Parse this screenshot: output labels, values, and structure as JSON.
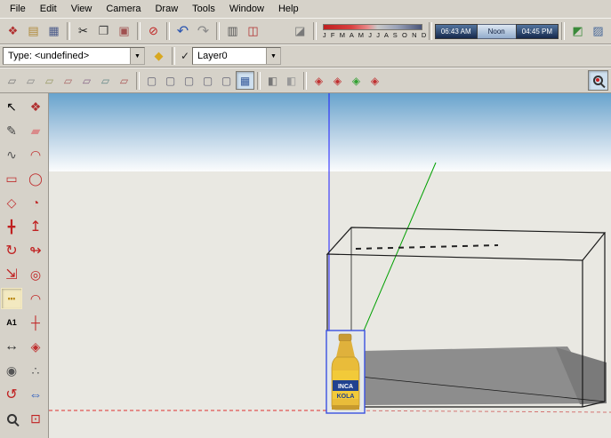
{
  "menu": [
    "File",
    "Edit",
    "View",
    "Camera",
    "Draw",
    "Tools",
    "Window",
    "Help"
  ],
  "shadows": {
    "months": "J F M A M J J A S O N D",
    "start_time": "06:43 AM",
    "noon": "Noon",
    "end_time": "04:45 PM"
  },
  "entity_info": {
    "type_field": "Type: <undefined>"
  },
  "layers": {
    "check": "✓",
    "current_layer": "Layer0"
  },
  "glyphs": {
    "make_component": "❖",
    "open": "▤",
    "save": "▦",
    "cut": "✂",
    "copy": "❐",
    "paste": "▣",
    "erase": "⊘",
    "undo": "↶",
    "redo": "↷",
    "print": "▥",
    "model_info": "◫",
    "shadow_toggle": "◪",
    "get_models": "◩",
    "share_model": "▨",
    "paint_bucket": "◆",
    "dropdown": "▼",
    "sandbox": "▱",
    "face_style": "▢",
    "face_style_active": "▦",
    "misc_view": "◧",
    "section": "◈",
    "select": "↖",
    "line": "✎",
    "eraser": "▰",
    "freehand": "∿",
    "arc": "◠",
    "rectangle": "▭",
    "circle": "◯",
    "polygon": "◇",
    "pie": "◔",
    "move": "╋",
    "push_pull": "↥",
    "rotate": "↻",
    "follow_me": "↬",
    "scale": "⇲",
    "offset": "◎",
    "tape_measure": "┅",
    "text_tool": "A1",
    "protractor": "◠",
    "axes": "┼",
    "dimension": "↔",
    "section_plane": "◈",
    "position_camera": "◉",
    "walk": "∴",
    "orbit": "↺",
    "pan": "⇔",
    "zoom_extents": "⊡"
  },
  "canvas": {
    "bottle": {
      "line1": "INCA",
      "line2": "KOLA"
    }
  },
  "colors": {
    "sky_top": "#68a3cd",
    "ground": "#e9e8e2",
    "axis_blue": "#1c1cff",
    "axis_green": "#00a000",
    "axis_red": "#e03030",
    "shadow_gray": "#8d8d8d",
    "selection_blue": "#3a50e0",
    "bottle_yellow": "#e9bc3a",
    "label_blue": "#20418f"
  }
}
